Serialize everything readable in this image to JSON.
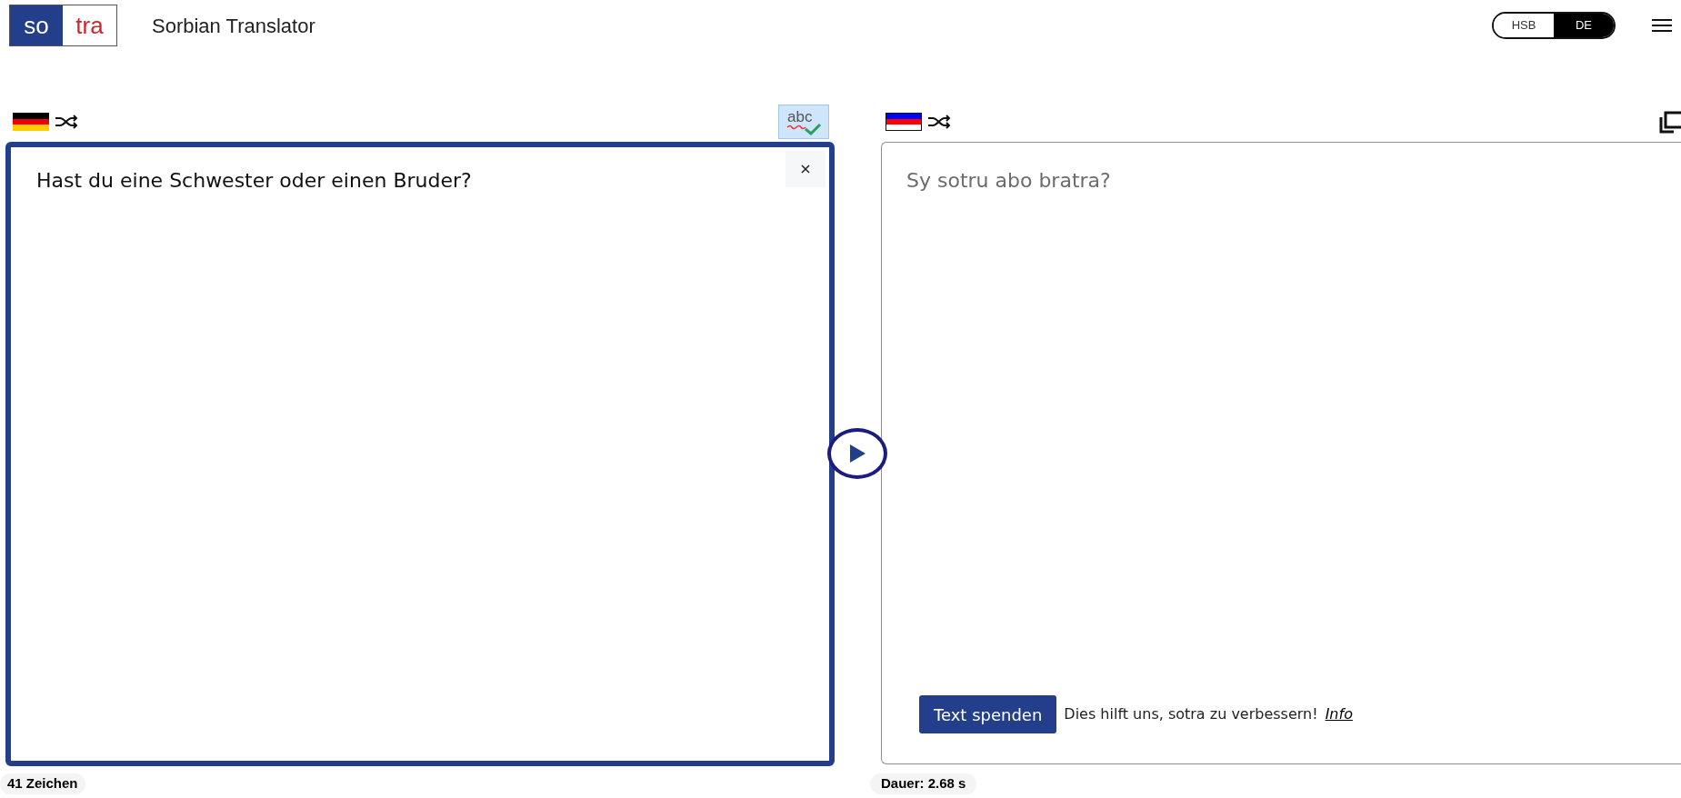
{
  "header": {
    "logo": [
      "so",
      "tra"
    ],
    "title": "Sorbian Translator",
    "ui_languages": [
      {
        "label": "HSB",
        "selected": false
      },
      {
        "label": "DE",
        "selected": true
      }
    ]
  },
  "source": {
    "text": "Hast du eine Schwester oder einen Bruder?",
    "spellcheck_label": "abc",
    "spellcheck_on": true,
    "char_count": "41 Zeichen"
  },
  "target": {
    "text": "Sy sotru abo bratra?",
    "donate_button": "Text spenden",
    "donate_note": "Dies hilft uns, sotra zu verbessern!",
    "info_link": "Info",
    "duration": "Dauer: 2.68 s"
  }
}
